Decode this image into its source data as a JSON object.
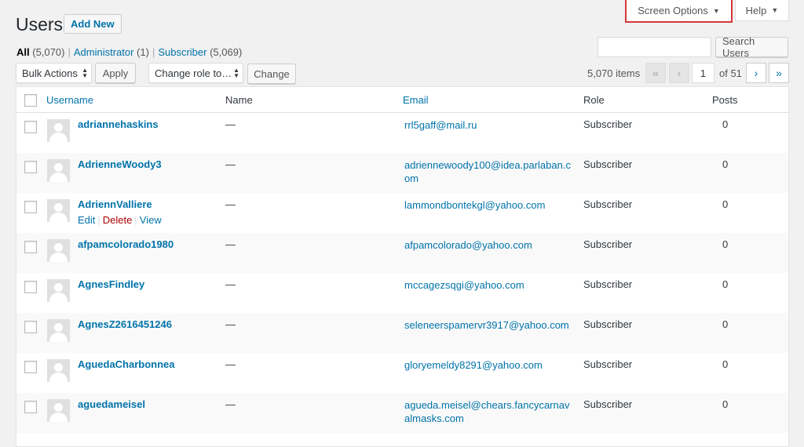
{
  "header": {
    "title": "Users",
    "add_new": "Add New",
    "screen_options": "Screen Options",
    "help": "Help"
  },
  "filters": {
    "all_label": "All",
    "all_count": "(5,070)",
    "admin_label": "Administrator",
    "admin_count": "(1)",
    "subscriber_label": "Subscriber",
    "subscriber_count": "(5,069)",
    "separator": "|"
  },
  "search": {
    "button": "Search Users",
    "value": ""
  },
  "tablenav": {
    "bulk_actions": "Bulk Actions",
    "apply": "Apply",
    "change_role": "Change role to…",
    "change": "Change",
    "items": "5,070 items",
    "first": "«",
    "prev": "‹",
    "current_page": "1",
    "of_pages": "of 51",
    "next": "›",
    "last": "»"
  },
  "columns": {
    "username": "Username",
    "name": "Name",
    "email": "Email",
    "role": "Role",
    "posts": "Posts"
  },
  "row_actions": {
    "edit": "Edit",
    "delete": "Delete",
    "view": "View",
    "pipe": "|"
  },
  "users": [
    {
      "username": "adriannehaskins",
      "name": "—",
      "email": "rrl5gaff@mail.ru",
      "role": "Subscriber",
      "posts": "0"
    },
    {
      "username": "AdrienneWoody3",
      "name": "—",
      "email": "adriennewoody100@idea.parlaban.com",
      "role": "Subscriber",
      "posts": "0"
    },
    {
      "username": "AdriennValliere",
      "name": "—",
      "email": "lammondbontekgl@yahoo.com",
      "role": "Subscriber",
      "posts": "0"
    },
    {
      "username": "afpamcolorado1980",
      "name": "—",
      "email": "afpamcolorado@yahoo.com",
      "role": "Subscriber",
      "posts": "0"
    },
    {
      "username": "AgnesFindley",
      "name": "—",
      "email": "mccagezsqgi@yahoo.com",
      "role": "Subscriber",
      "posts": "0"
    },
    {
      "username": "AgnesZ2616451246",
      "name": "—",
      "email": "seleneerspamervr3917@yahoo.com",
      "role": "Subscriber",
      "posts": "0"
    },
    {
      "username": "AguedaCharbonnea",
      "name": "—",
      "email": "gloryemeldy8291@yahoo.com",
      "role": "Subscriber",
      "posts": "0"
    },
    {
      "username": "aguedameisel",
      "name": "—",
      "email": "agueda.meisel@chears.fancycarnavalmasks.com",
      "role": "Subscriber",
      "posts": "0"
    }
  ],
  "colors": {
    "link": "#0073aa",
    "delete": "#a00",
    "highlight": "#d63638"
  }
}
